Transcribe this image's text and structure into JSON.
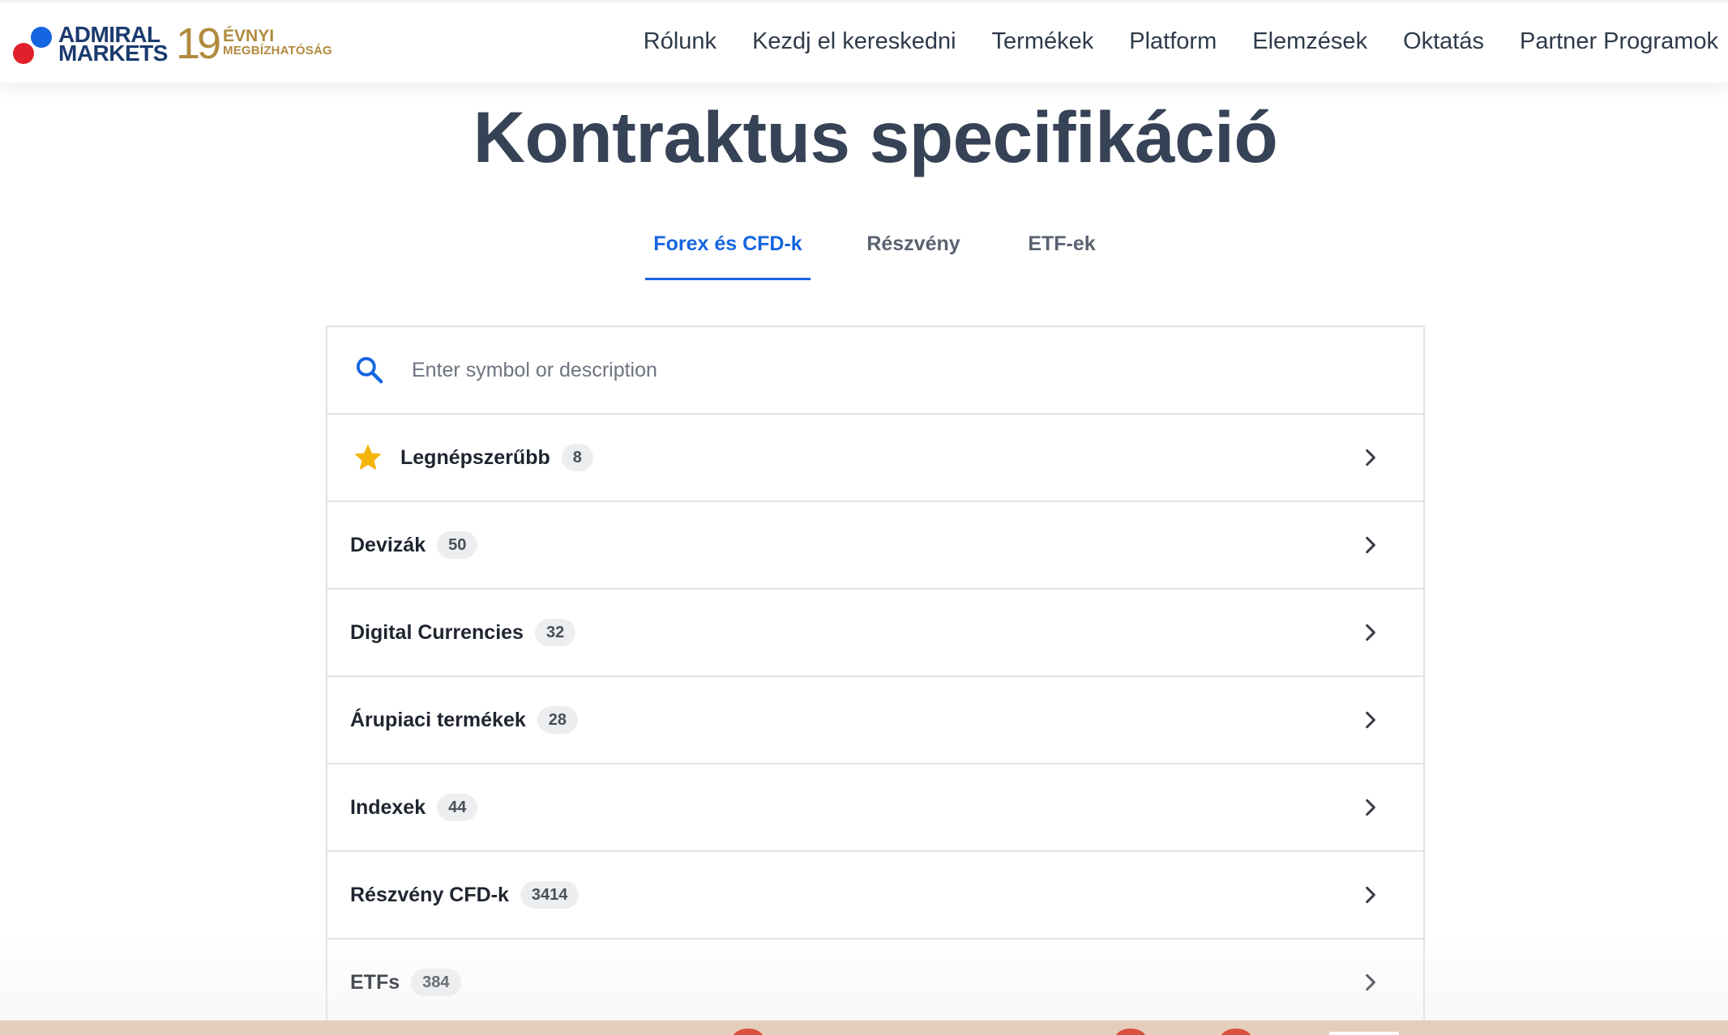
{
  "header": {
    "logo": {
      "line1": "ADMIRAL",
      "line2": "MARKETS",
      "years_number": "19",
      "years_line1": "ÉVNYI",
      "years_line2": "MEGBÍZHATÓSÁG",
      "colors": {
        "blue": "#1565e0",
        "red": "#e0202a",
        "navy": "#1b3a6e",
        "gold": "#b08a3e"
      }
    },
    "nav": [
      {
        "label": "Rólunk"
      },
      {
        "label": "Kezdj el kereskedni"
      },
      {
        "label": "Termékek"
      },
      {
        "label": "Platform"
      },
      {
        "label": "Elemzések"
      },
      {
        "label": "Oktatás"
      },
      {
        "label": "Partner Programok"
      }
    ]
  },
  "main": {
    "title": "Kontraktus specifikáció",
    "tabs": [
      {
        "label": "Forex és CFD-k",
        "active": true
      },
      {
        "label": "Részvény",
        "active": false
      },
      {
        "label": "ETF-ek",
        "active": false
      }
    ],
    "search": {
      "placeholder": "Enter symbol or description",
      "value": "",
      "icon": "search-icon"
    },
    "categories": [
      {
        "label": "Legnépszerűbb",
        "count": "8",
        "icon": "star-icon"
      },
      {
        "label": "Devizák",
        "count": "50"
      },
      {
        "label": "Digital Currencies",
        "count": "32"
      },
      {
        "label": "Árupiaci termékek",
        "count": "28"
      },
      {
        "label": "Indexek",
        "count": "44"
      },
      {
        "label": "Részvény CFD-k",
        "count": "3414"
      },
      {
        "label": "ETFs",
        "count": "384"
      }
    ],
    "accent_color": "#1565e0",
    "star_color": "#f5b50a"
  }
}
